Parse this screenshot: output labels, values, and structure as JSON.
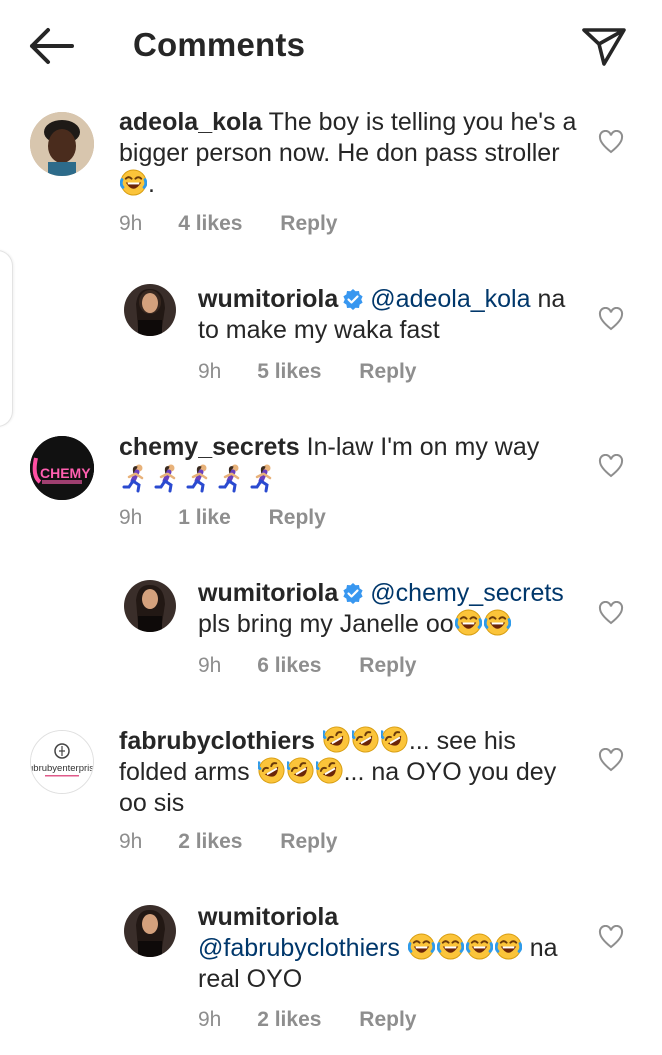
{
  "header": {
    "title": "Comments",
    "back_icon": "arrow-left-icon",
    "share_icon": "paper-plane-icon"
  },
  "comments": [
    {
      "username": "adeola_kola",
      "text": "The boy is telling you he's a bigger person now. He don pass stroller",
      "trailing": ".",
      "time": "9h",
      "likes": "4 likes",
      "reply": "Reply"
    },
    {
      "username": "wumitoriola",
      "mention": "@adeola_kola",
      "text": "na to make my waka fast",
      "time": "9h",
      "likes": "5 likes",
      "reply": "Reply"
    },
    {
      "username": "chemy_secrets",
      "text": "In-law I'm on my way",
      "time": "9h",
      "likes": "1 like",
      "reply": "Reply",
      "avatar_text": "CHEMY"
    },
    {
      "username": "wumitoriola",
      "mention": "@chemy_secrets",
      "text": "pls bring my Janelle oo",
      "time": "9h",
      "likes": "6 likes",
      "reply": "Reply"
    },
    {
      "username": "fabrubyclothiers",
      "text1": "... see his",
      "text2": "folded arms",
      "text3": "... na OYO you dey",
      "text4": "oo sis",
      "time": "9h",
      "likes": "2 likes",
      "reply": "Reply",
      "avatar_text": "ubrubyenterpris"
    },
    {
      "username": "wumitoriola",
      "mention": "@fabrubyclothiers",
      "text": "na",
      "text2": "real OYO",
      "time": "9h",
      "likes": "2 likes",
      "reply": "Reply"
    }
  ],
  "colors": {
    "text": "#262626",
    "meta": "#8e8e8e",
    "mention": "#00376b",
    "verified": "#3897f0"
  }
}
